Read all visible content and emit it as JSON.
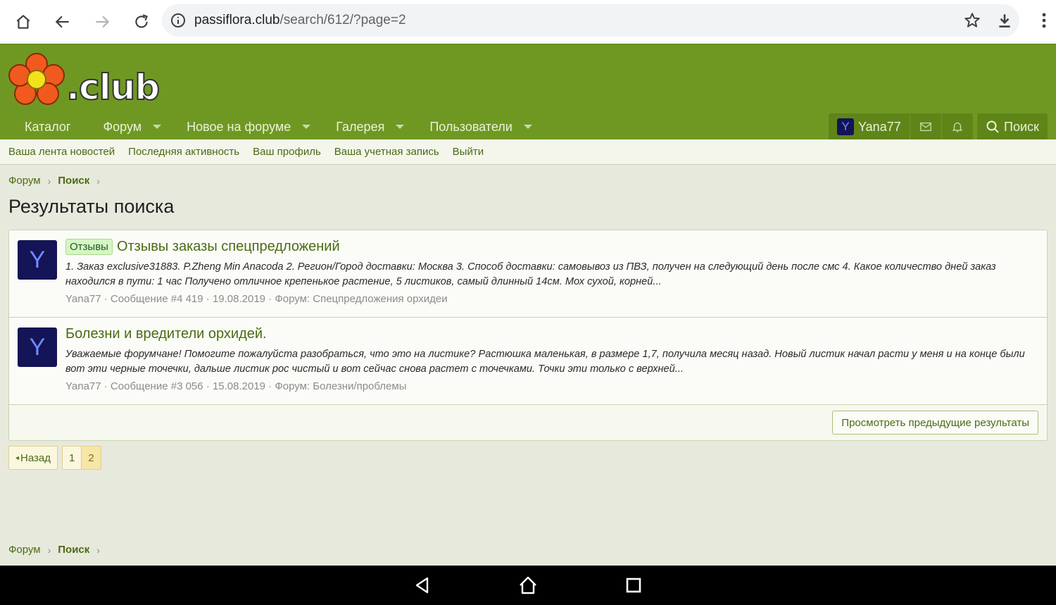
{
  "browser": {
    "url_host": "passiflora.club",
    "url_path": "/search/612/?page=2"
  },
  "site": {
    "logo_text": ".club"
  },
  "nav": {
    "items": [
      {
        "label": "Каталог"
      },
      {
        "label": "Форум"
      },
      {
        "label": "Новое на форуме"
      },
      {
        "label": "Галерея"
      },
      {
        "label": "Пользователи"
      }
    ],
    "username": "Yana77",
    "user_avatar_letter": "Y",
    "search_label": "Поиск"
  },
  "subnav": {
    "items": [
      {
        "label": "Ваша лента новостей"
      },
      {
        "label": "Последняя активность"
      },
      {
        "label": "Ваш профиль"
      },
      {
        "label": "Ваша учетная запись"
      },
      {
        "label": "Выйти"
      }
    ]
  },
  "breadcrumb": {
    "root": "Форум",
    "current": "Поиск"
  },
  "page_title": "Результаты поиска",
  "results": [
    {
      "avatar_letter": "Y",
      "label": "Отзывы",
      "title": "Отзывы заказы спецпредложений",
      "snippet": "1. Заказ exclusive31883. P.Zheng Min Anacoda 2. Регион/Город доставки: Москва 3. Способ доставки: самовывоз из ПВЗ, получен на следующий день после смс 4. Какое количество дней заказ находился в пути: 1 час Получено отличное крепенькое растение, 5 листиков, самый длинный 14см. Мох сухой, корней...",
      "meta": "Yana77 · Сообщение #4 419 · 19.08.2019 · Форум:   Спецпредложения орхидеи"
    },
    {
      "avatar_letter": "Y",
      "label": "",
      "title": "Болезни и вредители орхидей.",
      "snippet": "Уважаемые форумчане! Помогите пожалуйста разобраться, что это на листике? Растюшка маленькая, в размере 1,7, получила месяц назад. Новый листик начал расти у меня и на конце были вот эти черные точечки, дальше листик рос чистый и вот сейчас снова растет с точечками. Точки эти только с верхней...",
      "meta": "Yana77 · Сообщение #3 056 · 15.08.2019 · Форум: Болезни/проблемы"
    }
  ],
  "prev_results_label": "Просмотреть предыдущие результаты",
  "pager": {
    "back_label": "Назад",
    "pages": [
      "1",
      "2"
    ],
    "current_page": "2"
  },
  "colors": {
    "header_green": "#6f9823",
    "link_green": "#4a6b14",
    "avatar_navy": "#141456"
  }
}
